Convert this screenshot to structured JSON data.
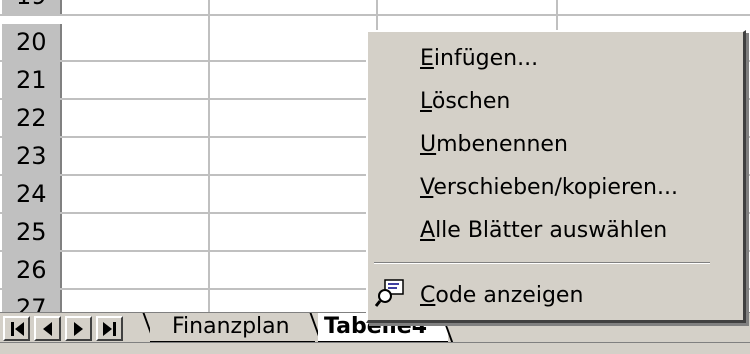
{
  "grid": {
    "rows": [
      "19",
      "20",
      "21",
      "22",
      "23",
      "24",
      "25",
      "26",
      "27"
    ]
  },
  "sheet_tabs": {
    "nav_buttons": [
      "first-sheet",
      "previous-sheet",
      "next-sheet",
      "last-sheet"
    ],
    "tabs": [
      {
        "label": "Finanzplan",
        "active": false
      },
      {
        "label": "Tabelle4",
        "active": true
      }
    ]
  },
  "context_menu": {
    "items": [
      {
        "label": "Einfügen...",
        "accel": "E"
      },
      {
        "label": "Löschen",
        "accel": "L"
      },
      {
        "label": "Umbenennen",
        "accel": "U"
      },
      {
        "label": "Verschieben/kopieren...",
        "accel": "V"
      },
      {
        "label": "Alle Blätter auswählen",
        "accel": "A"
      }
    ],
    "code_item": {
      "label": "Code anzeigen",
      "accel": "C",
      "icon": "code-view-icon"
    }
  }
}
